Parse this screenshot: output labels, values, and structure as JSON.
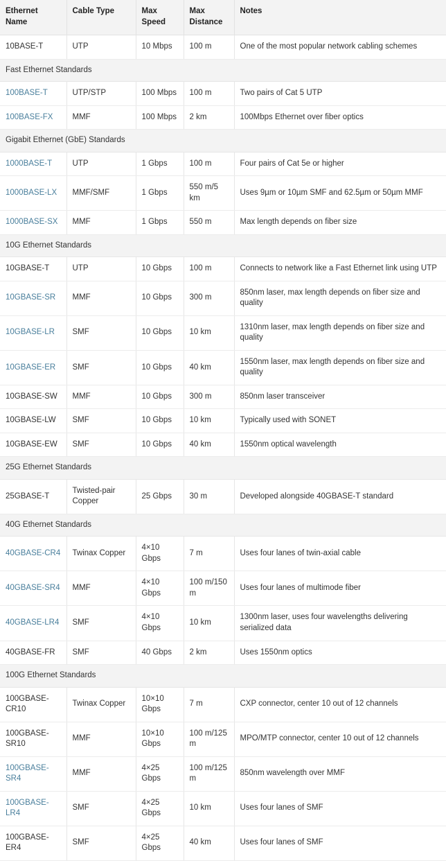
{
  "table": {
    "columns": [
      {
        "label": "Ethernet Name"
      },
      {
        "label": "Cable Type"
      },
      {
        "label": "Max Speed"
      },
      {
        "label": "Max Distance"
      },
      {
        "label": "Notes"
      }
    ],
    "link_color": "#4a7f9c",
    "header_bg": "#f3f3f3",
    "section_bg": "#f3f3f3",
    "text_color": "#333333",
    "rows": [
      {
        "type": "data",
        "name": "10BASE-T",
        "is_link": false,
        "cable": "UTP",
        "speed": "10 Mbps",
        "distance": "100 m",
        "notes": "One of the most popular network cabling schemes"
      },
      {
        "type": "section",
        "title": "Fast Ethernet Standards"
      },
      {
        "type": "data",
        "name": "100BASE-T",
        "is_link": true,
        "cable": "UTP/STP",
        "speed": "100 Mbps",
        "distance": "100 m",
        "notes": "Two pairs of Cat 5 UTP"
      },
      {
        "type": "data",
        "name": "100BASE-FX",
        "is_link": true,
        "cable": "MMF",
        "speed": "100 Mbps",
        "distance": "2 km",
        "notes": "100Mbps Ethernet over fiber optics"
      },
      {
        "type": "section",
        "title": "Gigabit Ethernet (GbE) Standards"
      },
      {
        "type": "data",
        "name": "1000BASE-T",
        "is_link": true,
        "cable": "UTP",
        "speed": "1 Gbps",
        "distance": "100 m",
        "notes": "Four pairs of Cat 5e or higher"
      },
      {
        "type": "data",
        "name": "1000BASE-LX",
        "is_link": true,
        "cable": "MMF/SMF",
        "speed": "1 Gbps",
        "distance": "550 m/5 km",
        "notes": "Uses 9µm or 10µm SMF and 62.5µm or 50µm MMF"
      },
      {
        "type": "data",
        "name": "1000BASE-SX",
        "is_link": true,
        "cable": "MMF",
        "speed": "1 Gbps",
        "distance": "550 m",
        "notes": "Max length depends on fiber size"
      },
      {
        "type": "section",
        "title": "10G Ethernet Standards"
      },
      {
        "type": "data",
        "name": "10GBASE-T",
        "is_link": false,
        "cable": "UTP",
        "speed": "10 Gbps",
        "distance": "100 m",
        "notes": "Connects to network like a Fast Ethernet link using UTP"
      },
      {
        "type": "data",
        "name": "10GBASE-SR",
        "is_link": true,
        "cable": "MMF",
        "speed": "10 Gbps",
        "distance": "300 m",
        "notes": "850nm laser, max length depends on fiber size and quality"
      },
      {
        "type": "data",
        "name": "10GBASE-LR",
        "is_link": true,
        "cable": "SMF",
        "speed": "10 Gbps",
        "distance": "10 km",
        "notes": "1310nm laser, max length depends on fiber size and quality"
      },
      {
        "type": "data",
        "name": "10GBASE-ER",
        "is_link": true,
        "cable": "SMF",
        "speed": "10 Gbps",
        "distance": "40 km",
        "notes": "1550nm laser, max length depends on fiber size and quality"
      },
      {
        "type": "data",
        "name": "10GBASE-SW",
        "is_link": false,
        "cable": "MMF",
        "speed": "10 Gbps",
        "distance": "300 m",
        "notes": "850nm laser transceiver"
      },
      {
        "type": "data",
        "name": "10GBASE-LW",
        "is_link": false,
        "cable": "SMF",
        "speed": "10 Gbps",
        "distance": "10 km",
        "notes": "Typically used with SONET"
      },
      {
        "type": "data",
        "name": "10GBASE-EW",
        "is_link": false,
        "cable": "SMF",
        "speed": "10 Gbps",
        "distance": "40 km",
        "notes": "1550nm optical wavelength"
      },
      {
        "type": "section",
        "title": "25G Ethernet Standards"
      },
      {
        "type": "data",
        "name": "25GBASE-T",
        "is_link": false,
        "cable": "Twisted-pair Copper",
        "speed": "25 Gbps",
        "distance": "30 m",
        "notes": "Developed alongside 40GBASE-T standard"
      },
      {
        "type": "section",
        "title": "40G Ethernet Standards"
      },
      {
        "type": "data",
        "name": "40GBASE-CR4",
        "is_link": true,
        "cable": "Twinax Copper",
        "speed": "4×10 Gbps",
        "distance": "7 m",
        "notes": "Uses four lanes of twin-axial cable"
      },
      {
        "type": "data",
        "name": "40GBASE-SR4",
        "is_link": true,
        "cable": "MMF",
        "speed": "4×10 Gbps",
        "distance": "100 m/150 m",
        "notes": "Uses four lanes of multimode fiber"
      },
      {
        "type": "data",
        "name": "40GBASE-LR4",
        "is_link": true,
        "cable": "SMF",
        "speed": "4×10 Gbps",
        "distance": "10 km",
        "notes": "1300nm laser, uses four wavelengths delivering serialized data"
      },
      {
        "type": "data",
        "name": "40GBASE-FR",
        "is_link": false,
        "cable": "SMF",
        "speed": "40 Gbps",
        "distance": "2 km",
        "notes": "Uses 1550nm optics"
      },
      {
        "type": "section",
        "title": "100G Ethernet Standards"
      },
      {
        "type": "data",
        "name": "100GBASE-CR10",
        "is_link": false,
        "cable": "Twinax Copper",
        "speed": "10×10 Gbps",
        "distance": "7 m",
        "notes": "CXP connector, center 10 out of 12 channels"
      },
      {
        "type": "data",
        "name": "100GBASE-SR10",
        "is_link": false,
        "cable": "MMF",
        "speed": "10×10 Gbps",
        "distance": "100 m/125 m",
        "notes": "MPO/MTP connector, center 10 out of 12 channels"
      },
      {
        "type": "data",
        "name": "100GBASE-SR4",
        "is_link": true,
        "cable": "MMF",
        "speed": "4×25 Gbps",
        "distance": "100 m/125 m",
        "notes": "850nm wavelength over MMF"
      },
      {
        "type": "data",
        "name": "100GBASE-LR4",
        "is_link": true,
        "cable": "SMF",
        "speed": "4×25 Gbps",
        "distance": "10 km",
        "notes": "Uses four lanes of SMF"
      },
      {
        "type": "data",
        "name": "100GBASE-ER4",
        "is_link": false,
        "cable": "SMF",
        "speed": "4×25 Gbps",
        "distance": "40 km",
        "notes": "Uses four lanes of SMF"
      }
    ]
  }
}
